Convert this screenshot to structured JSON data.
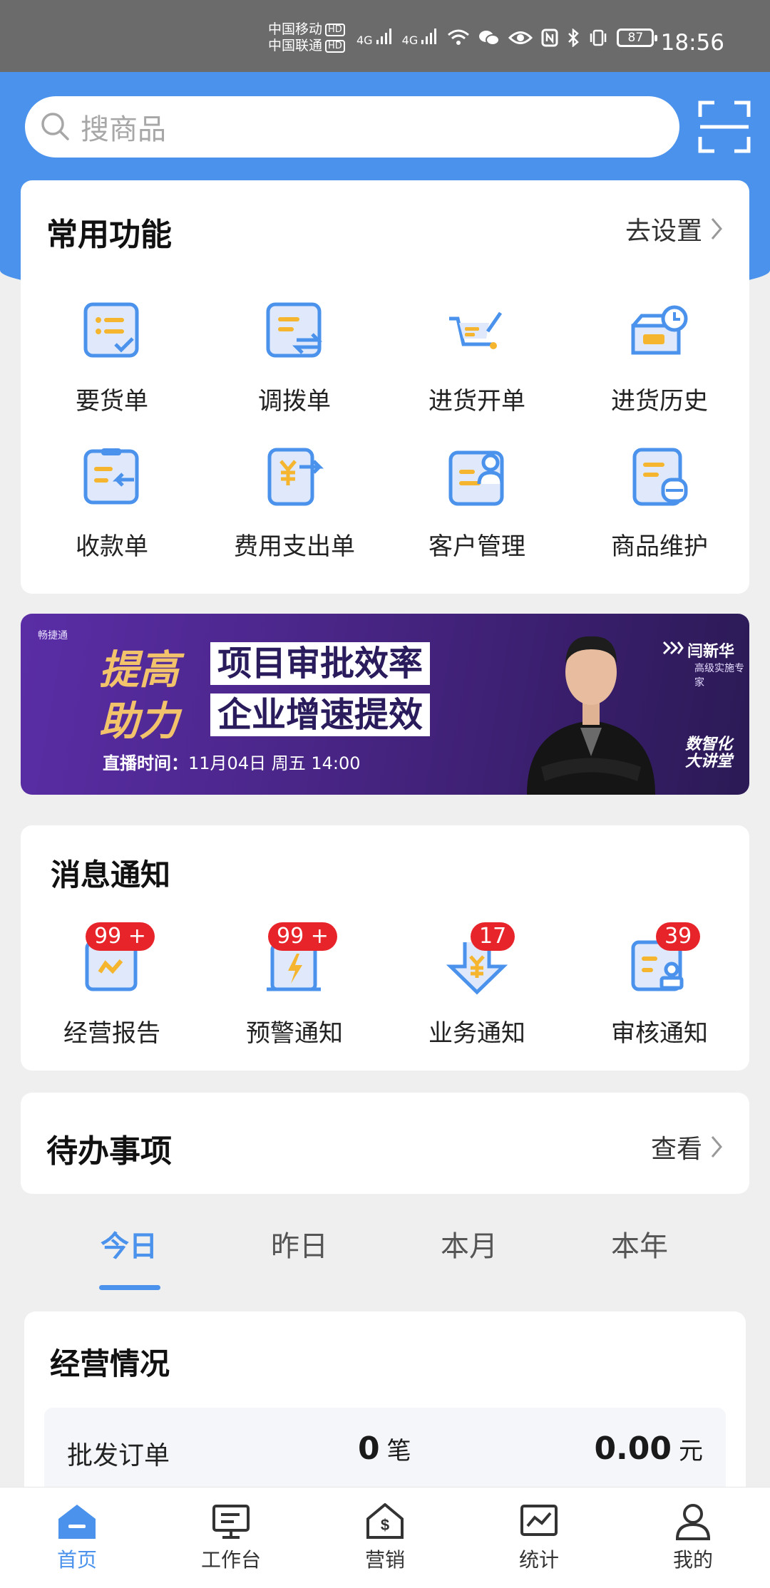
{
  "status_bar": {
    "carrier1": "中国移动",
    "carrier2": "中国联通",
    "hd": "HD",
    "signal": "4G",
    "battery": "87",
    "time": "18:56"
  },
  "search": {
    "placeholder": "搜商品"
  },
  "common_functions": {
    "title": "常用功能",
    "settings_link": "去设置",
    "items": [
      {
        "label": "要货单",
        "icon": "order-list-icon"
      },
      {
        "label": "调拨单",
        "icon": "transfer-icon"
      },
      {
        "label": "进货开单",
        "icon": "cart-icon"
      },
      {
        "label": "进货历史",
        "icon": "history-icon"
      },
      {
        "label": "收款单",
        "icon": "receipt-icon"
      },
      {
        "label": "费用支出单",
        "icon": "expense-icon"
      },
      {
        "label": "客户管理",
        "icon": "customer-icon"
      },
      {
        "label": "商品维护",
        "icon": "product-icon"
      }
    ]
  },
  "banner": {
    "brand": "畅捷通",
    "line1_a": "提高",
    "line1_b": "项目审批效率",
    "line2_a": "助力",
    "line2_b": "企业增速提效",
    "time_label": "直播时间：",
    "time_value": "11月04日  周五 14:00",
    "speaker_name": "闫新华",
    "speaker_role": "高级实施专家",
    "tag_line1": "数智化",
    "tag_line2": "大讲堂"
  },
  "notifications": {
    "title": "消息通知",
    "items": [
      {
        "label": "经营报告",
        "badge": "99 +",
        "icon": "report-icon"
      },
      {
        "label": "预警通知",
        "badge": "99 +",
        "icon": "warning-icon"
      },
      {
        "label": "业务通知",
        "badge": "17",
        "icon": "business-icon"
      },
      {
        "label": "审核通知",
        "badge": "39",
        "icon": "audit-icon"
      }
    ]
  },
  "todo": {
    "title": "待办事项",
    "view_link": "查看"
  },
  "period_tabs": [
    "今日",
    "昨日",
    "本月",
    "本年"
  ],
  "business": {
    "title": "经营情况",
    "rows": [
      {
        "label": "批发订单",
        "count": "0",
        "count_unit": "笔",
        "amount": "0.00",
        "amount_unit": "元"
      }
    ]
  },
  "bottom_nav": [
    {
      "label": "首页",
      "icon": "home-icon"
    },
    {
      "label": "工作台",
      "icon": "workbench-icon"
    },
    {
      "label": "营销",
      "icon": "marketing-icon"
    },
    {
      "label": "统计",
      "icon": "statistics-icon"
    },
    {
      "label": "我的",
      "icon": "profile-icon"
    }
  ],
  "colors": {
    "primary": "#4a92ec",
    "badge": "#e8242b",
    "icon_yellow": "#f5b52e"
  }
}
